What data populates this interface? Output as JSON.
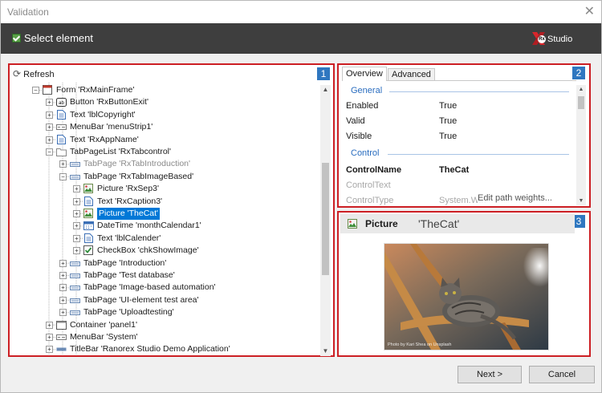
{
  "window": {
    "title": "Validation",
    "close_symbol": "✕"
  },
  "header": {
    "select_label": "Select element",
    "logo_text": "Studio",
    "logo_badge": "Rx"
  },
  "panel1": {
    "badge": "1",
    "refresh_label": "Refresh",
    "tree": [
      {
        "label": "Form 'RxMainFrame'",
        "icon": "form-icon",
        "level": 0,
        "expander": "-",
        "dim": false
      },
      {
        "label": "Button 'RxButtonExit'",
        "icon": "button-icon",
        "level": 1,
        "expander": "+",
        "dim": false
      },
      {
        "label": "Text 'lblCopyright'",
        "icon": "text-icon",
        "level": 1,
        "expander": "+",
        "dim": false
      },
      {
        "label": "MenuBar 'menuStrip1'",
        "icon": "menubar-icon",
        "level": 1,
        "expander": "+",
        "dim": false
      },
      {
        "label": "Text 'RxAppName'",
        "icon": "text-icon",
        "level": 1,
        "expander": "+",
        "dim": false
      },
      {
        "label": "TabPageList 'RxTabcontrol'",
        "icon": "folder-icon",
        "level": 1,
        "expander": "-",
        "dim": false
      },
      {
        "label": "TabPage 'RxTabIntroduction'",
        "icon": "tabpage-icon",
        "level": 2,
        "expander": "+",
        "dim": true
      },
      {
        "label": "TabPage 'RxTabImageBased'",
        "icon": "tabpage-icon",
        "level": 2,
        "expander": "-",
        "dim": false
      },
      {
        "label": "Picture 'RxSep3'",
        "icon": "picture-icon",
        "level": 3,
        "expander": "+",
        "dim": false
      },
      {
        "label": "Text 'RxCaption3'",
        "icon": "text-icon",
        "level": 3,
        "expander": "+",
        "dim": false
      },
      {
        "label": "Picture 'TheCat'",
        "icon": "picture-icon",
        "level": 3,
        "expander": "+",
        "dim": false,
        "selected": true
      },
      {
        "label": "DateTime 'monthCalendar1'",
        "icon": "datetime-icon",
        "level": 3,
        "expander": "+",
        "dim": false
      },
      {
        "label": "Text 'lblCalender'",
        "icon": "text-icon",
        "level": 3,
        "expander": "+",
        "dim": false
      },
      {
        "label": "CheckBox 'chkShowImage'",
        "icon": "checkbox-icon",
        "level": 3,
        "expander": "+",
        "dim": false
      },
      {
        "label": "TabPage 'Introduction'",
        "icon": "tabpage-icon",
        "level": 2,
        "expander": "+",
        "dim": false
      },
      {
        "label": "TabPage 'Test database'",
        "icon": "tabpage-icon",
        "level": 2,
        "expander": "+",
        "dim": false
      },
      {
        "label": "TabPage 'Image-based automation'",
        "icon": "tabpage-icon",
        "level": 2,
        "expander": "+",
        "dim": false
      },
      {
        "label": "TabPage 'UI-element test area'",
        "icon": "tabpage-icon",
        "level": 2,
        "expander": "+",
        "dim": false
      },
      {
        "label": "TabPage 'Uploadtesting'",
        "icon": "tabpage-icon",
        "level": 2,
        "expander": "+",
        "dim": false
      },
      {
        "label": "Container 'panel1'",
        "icon": "container-icon",
        "level": 1,
        "expander": "+",
        "dim": false
      },
      {
        "label": "MenuBar 'System'",
        "icon": "menubar-icon",
        "level": 1,
        "expander": "+",
        "dim": false
      },
      {
        "label": "TitleBar 'Ranorex Studio Demo Application'",
        "icon": "titlebar-icon",
        "level": 1,
        "expander": "+",
        "dim": false
      }
    ]
  },
  "panel2": {
    "badge": "2",
    "tabs": [
      "Overview",
      "Advanced"
    ],
    "sections": [
      {
        "title": "General",
        "rows": [
          {
            "key": "Enabled",
            "value": "True"
          },
          {
            "key": "Valid",
            "value": "True"
          },
          {
            "key": "Visible",
            "value": "True"
          }
        ]
      },
      {
        "title": "Control",
        "rows": [
          {
            "key": "ControlName",
            "value": "TheCat",
            "bold": true
          },
          {
            "key": "ControlText",
            "value": "",
            "dim": true
          },
          {
            "key": "ControlType",
            "value": "System.W...",
            "dim": true
          }
        ]
      }
    ],
    "edit_link": "Edit path weights..."
  },
  "panel3": {
    "badge": "3",
    "type": "Picture",
    "name": "'TheCat'",
    "photo_credit": "Photo by Kari Shea on Unsplash"
  },
  "buttons": {
    "next": "Next >",
    "cancel": "Cancel"
  },
  "colors": {
    "highlight_border": "#cc1f24",
    "badge": "#2f77c0",
    "selection": "#0078d7",
    "header": "#3e3e3e"
  }
}
